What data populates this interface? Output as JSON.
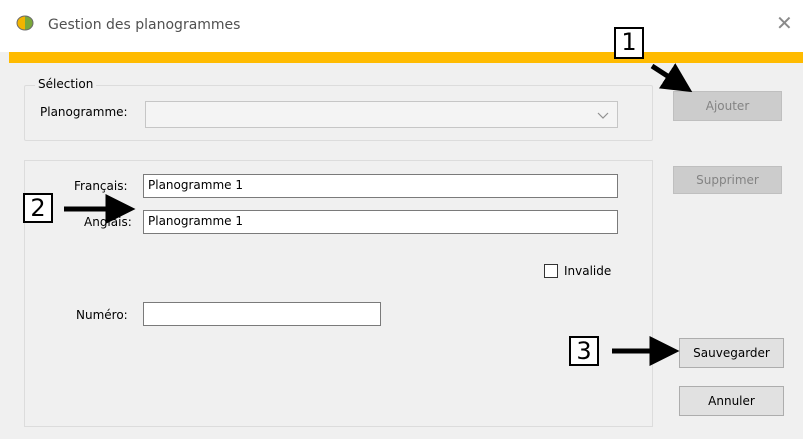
{
  "window": {
    "title": "Gestion des planogrammes",
    "app_icon": "app-logo-icon",
    "close_icon": "close-icon",
    "accent_color": "#ffbb00"
  },
  "selection": {
    "group_label": "Sélection",
    "planogramme_label": "Planogramme:",
    "planogramme_value": ""
  },
  "form": {
    "francais_label": "Français:",
    "francais_value": "Planogramme 1",
    "anglais_label": "Anglais:",
    "anglais_value": "Planogramme 1",
    "invalide_label": "Invalide",
    "invalide_checked": false,
    "numero_label": "Numéro:",
    "numero_value": ""
  },
  "buttons": {
    "ajouter": "Ajouter",
    "supprimer": "Supprimer",
    "sauvegarder": "Sauvegarder",
    "annuler": "Annuler"
  },
  "annotations": {
    "callout_1": "1",
    "callout_2": "2",
    "callout_3": "3"
  }
}
